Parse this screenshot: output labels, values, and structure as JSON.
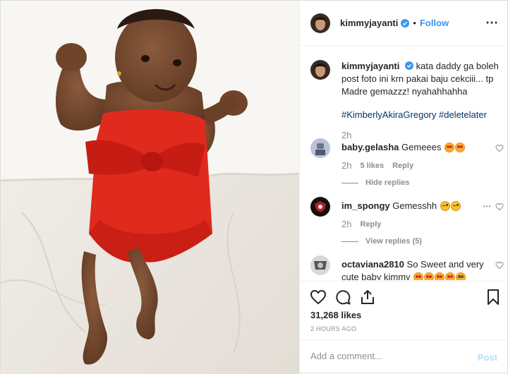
{
  "post": {
    "username": "kimmyjayanti",
    "follow_label": "Follow",
    "separator": "•",
    "more_icon": "more-horizontal-icon"
  },
  "caption": {
    "username": "kimmyjayanti",
    "text": "kata daddy ga boleh post foto ini krn pakai baju cekciii... tp Madre gemazzz! nyahahhahha",
    "hashtags": "#KimberlyAkiraGregory #deletelater",
    "time": "2h"
  },
  "comments": [
    {
      "username": "baby.gelasha",
      "text": "Gemeees",
      "time": "2h",
      "likes": "5 likes",
      "reply": "Reply",
      "thread": "Hide replies"
    },
    {
      "username": "im_spongy",
      "text": "Gemesshh",
      "time": "2h",
      "reply": "Reply",
      "thread": "View replies (5)"
    },
    {
      "username": "octaviana2810",
      "text": "So Sweet and very cute baby kimmy"
    }
  ],
  "footer": {
    "likes": "31,268 likes",
    "ago": "2 HOURS AGO",
    "comment_placeholder": "Add a comment...",
    "post_label": "Post"
  },
  "colors": {
    "accent": "#3897f0",
    "muted": "#8e8e8e",
    "dress": "#e02a1e"
  }
}
